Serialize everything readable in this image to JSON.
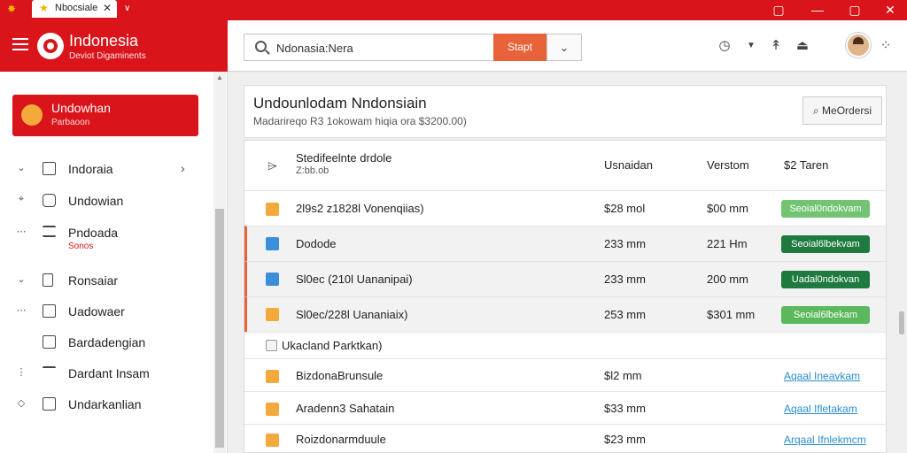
{
  "window": {
    "tab_title": "Nbocsiale",
    "tab_close": "✕",
    "new_tab": "∨",
    "controls": [
      "▢",
      "—",
      "▢",
      "✕"
    ]
  },
  "app": {
    "title": "Indonesia",
    "subtitle": "Deviot Digaminents"
  },
  "search": {
    "value": "Ndonasia:Nera",
    "button_label": "Stapt",
    "dropdown": "⌄"
  },
  "toolbar_icons": [
    "clock-icon",
    "chevron-down-icon",
    "pin-icon",
    "flask-icon",
    "grid-icon"
  ],
  "sidebar": {
    "card": {
      "title": "Undowhan",
      "subtitle": "Parbaoon"
    },
    "items": [
      {
        "label": "Indoraia",
        "lead": "⌄",
        "chevron": "›"
      },
      {
        "label": "Undowian",
        "lead": "⌖"
      },
      {
        "label": "Pndoada",
        "lead": "⋯",
        "sublabel": "Sonos"
      },
      {
        "label": "Ronsaiar",
        "lead": "⌄"
      },
      {
        "label": "Uadowaer",
        "lead": "⋯"
      },
      {
        "label": "Bardadengian",
        "lead": ""
      },
      {
        "label": "Dardant Insam",
        "lead": "⋮"
      },
      {
        "label": "Undarkanlian",
        "lead": "◇"
      }
    ]
  },
  "main": {
    "title": "Undounlodam Nndonsiain",
    "subtitle": "Madarireqo R3 1okowam hiqia ora $3200.00)",
    "more_button": "MeOrdersi",
    "table": {
      "header": {
        "name_line1": "Stedifeelnte drdole",
        "name_line2": "Z:bb.ob",
        "col2": "Usnaidan",
        "col3": "Verstom",
        "col4": "$2 Taren"
      },
      "rows": [
        {
          "name": "2l9s2 z1828l Vonenqiias)",
          "c2": "$28 mol",
          "c3": "$00 mm",
          "status": "Seoial0ndokvam",
          "status_style": "light",
          "icon_color": "#f4a93c",
          "shaded": false,
          "accent": false
        },
        {
          "name": "Dodode",
          "c2": "233 mm",
          "c3": "221 Hm",
          "status": "Seoial6lbekvam",
          "status_style": "dark",
          "icon_color": "#3a8fd9",
          "shaded": true,
          "accent": true
        },
        {
          "name": "Sl0ec (210l Uananipai)",
          "c2": "233 mm",
          "c3": "200 mm",
          "status": "Uadal0ndokvan",
          "status_style": "dark",
          "icon_color": "#3a8fd9",
          "shaded": true,
          "accent": true
        },
        {
          "name": "Sl0ec/228l Uananiaix)",
          "c2": "253 mm",
          "c3": "$301 mm",
          "status": "Seoial6lbekam",
          "status_style": "light",
          "icon_color": "#f4a93c",
          "shaded": true,
          "accent": true
        }
      ],
      "section_label": "Ukacland Parktkan)",
      "section_rows": [
        {
          "name": "BizdonaBrunsule",
          "c2": "$l2 mm",
          "status": "Aqaal Ineavkam"
        },
        {
          "name": "Aradenn3 Sahatain",
          "c2": "$33 mm",
          "status": "Aqaal Ifletakam"
        },
        {
          "name": "Roizdonarmduule",
          "c2": "$23 mm",
          "status": "Arqaal Ifnlekmcm"
        }
      ]
    }
  }
}
